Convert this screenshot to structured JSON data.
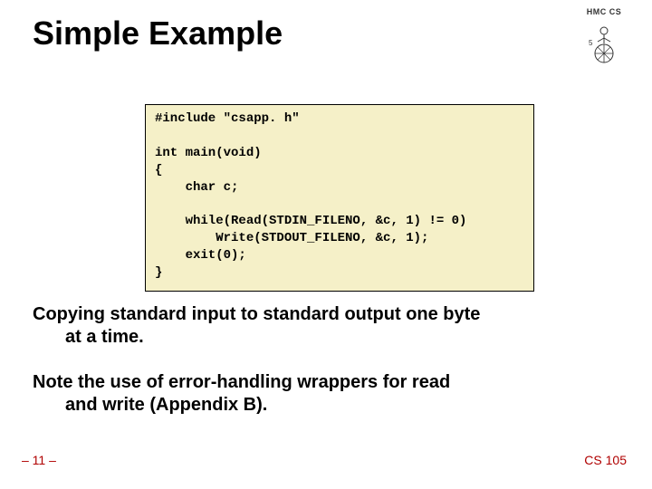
{
  "title": "Simple Example",
  "logo_text": "HMC CS",
  "code": "#include \"csapp. h\"\n\nint main(void)\n{\n    char c;\n\n    while(Read(STDIN_FILENO, &c, 1) != 0)\n        Write(STDOUT_FILENO, &c, 1);\n    exit(0);\n}",
  "body1_line1": "Copying standard input to standard output one byte",
  "body1_line2": "at a time.",
  "body2_line1": "Note the use of error-handling wrappers for read",
  "body2_line2": "and write (Appendix B).",
  "page_number": "– 11 –",
  "course": "CS 105"
}
